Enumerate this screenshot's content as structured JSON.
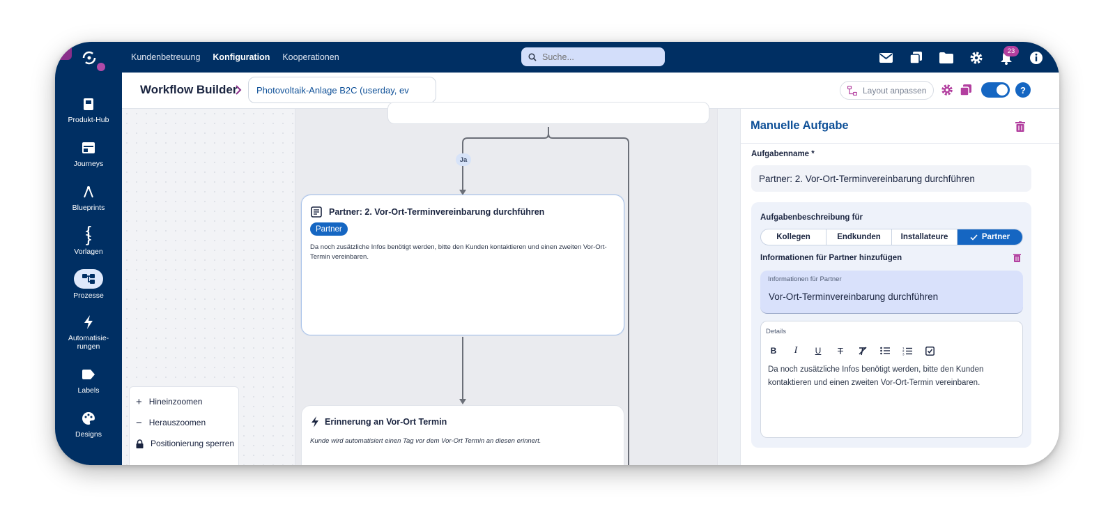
{
  "topnav": {
    "items": [
      "Kundenbetreuung",
      "Konfiguration",
      "Kooperationen"
    ],
    "active": "Konfiguration",
    "search_placeholder": "Suche...",
    "notification_count": "23"
  },
  "sidebar": {
    "items": [
      {
        "label": "Produkt-Hub",
        "icon": "book-icon"
      },
      {
        "label": "Journeys",
        "icon": "browser-window-icon"
      },
      {
        "label": "Blueprints",
        "icon": "compass-icon"
      },
      {
        "label": "Vorlagen",
        "icon": "curly-braces-icon"
      },
      {
        "label": "Prozesse",
        "icon": "process-tree-icon"
      },
      {
        "label": "Automatisie-\nrungen",
        "icon": "lightning-icon"
      },
      {
        "label": "Labels",
        "icon": "label-icon"
      },
      {
        "label": "Designs",
        "icon": "palette-icon"
      }
    ],
    "active": "Prozesse"
  },
  "header": {
    "title": "Workflow Builder",
    "workflow_select": "Photovoltaik-Anlage B2C (userday, ev",
    "layout_button": "Layout anpassen"
  },
  "canvas": {
    "branch_label": "Ja",
    "partner_node": {
      "title": "Partner: 2. Vor-Ort-Terminvereinbarung durchführen",
      "role": "Partner",
      "description": "Da noch zusätzliche Infos benötigt werden, bitte den Kunden kontaktieren und einen zweiten Vor-Ort-Termin vereinbaren."
    },
    "reminder_node": {
      "title": "Erinnerung an Vor-Ort Termin",
      "description": "Kunde wird automatisiert einen Tag vor dem Vor-Ort Termin an diesen erinnert."
    },
    "zoom_menu": {
      "zoom_in": "Hineinzoomen",
      "zoom_out": "Herauszoomen",
      "lock": "Positionierung sperren"
    }
  },
  "panel": {
    "title": "Manuelle Aufgabe",
    "task_name_label": "Aufgabenname *",
    "task_name_value": "Partner: 2. Vor-Ort-Terminvereinbarung durchführen",
    "description_for_label": "Aufgabenbeschreibung für",
    "audience_tabs": [
      "Kollegen",
      "Endkunden",
      "Installateure",
      "Partner"
    ],
    "audience_selected": "Partner",
    "info_heading": "Informationen für Partner hinzufügen",
    "info_field_label": "Informationen für Partner",
    "info_field_value": "Vor-Ort-Terminvereinbarung durchführen",
    "details_label": "Details",
    "details_text": "Da noch zusätzliche Infos benötigt werden, bitte den Kunden kontaktieren und einen zweiten Vor-Ort-Termin vereinbaren."
  },
  "colors": {
    "navy": "#002f63",
    "primary_blue": "#1566c2",
    "accent_purple": "#b23f9f",
    "panel_title_blue": "#0d4f97"
  }
}
